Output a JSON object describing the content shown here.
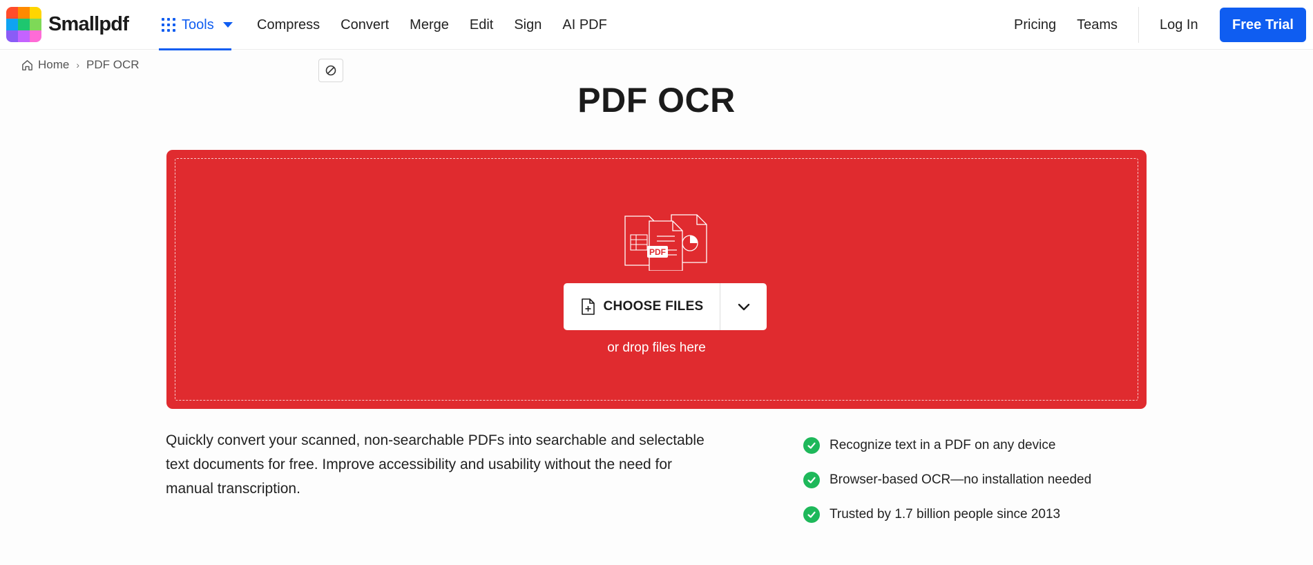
{
  "header": {
    "logo_text": "Smallpdf",
    "logo_colors": [
      "#ff4c2b",
      "#ffb400",
      "#ffd500",
      "#0fa3f2",
      "#1ec76f",
      "#7ed957",
      "#8a5cf6",
      "#c463ff",
      "#ff6bd6"
    ],
    "tools_label": "Tools",
    "nav_left": [
      "Compress",
      "Convert",
      "Merge",
      "Edit",
      "Sign",
      "AI PDF"
    ],
    "nav_right": [
      "Pricing",
      "Teams"
    ],
    "login_label": "Log In",
    "trial_label": "Free Trial"
  },
  "breadcrumb": {
    "home": "Home",
    "separator": "›",
    "current": "PDF OCR"
  },
  "page_title": "PDF OCR",
  "dropzone": {
    "illustration_badge": "PDF",
    "choose_label": "CHOOSE FILES",
    "hint": "or drop files here",
    "background_color": "#e02b2f"
  },
  "description": "Quickly convert your scanned, non-searchable PDFs into searchable and selectable text documents for free. Improve accessibility and usability without the need for manual transcription.",
  "features": [
    "Recognize text in a PDF on any device",
    "Browser-based OCR—no installation needed",
    "Trusted by 1.7 billion people since 2013"
  ],
  "colors": {
    "accent": "#0f5df1",
    "check": "#1eb85a"
  },
  "icons": [
    "grid-icon",
    "chevron-down-icon",
    "home-icon",
    "block-icon",
    "documents-illustration",
    "file-add-icon",
    "check-icon"
  ]
}
